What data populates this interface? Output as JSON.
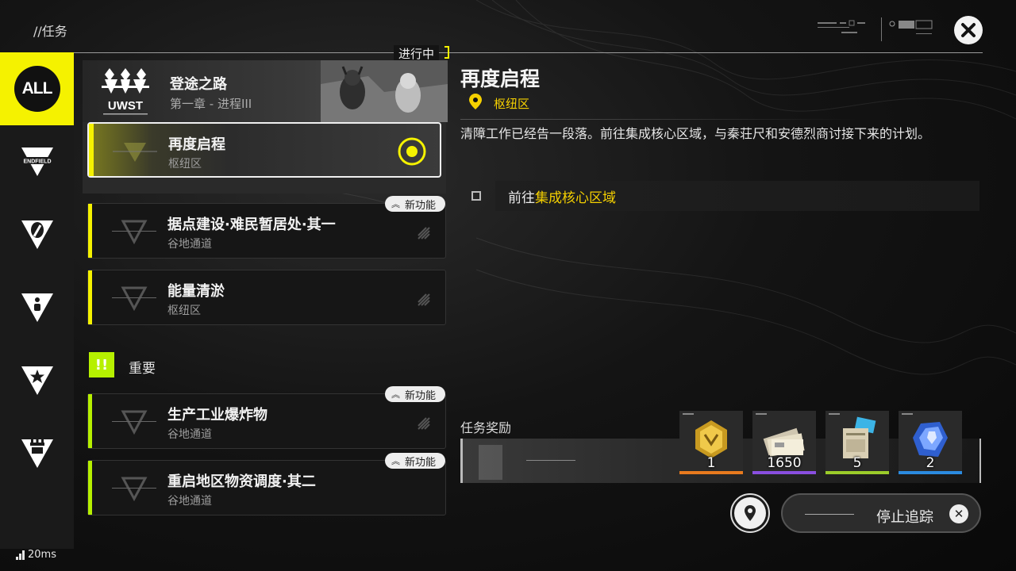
{
  "header": {
    "title": "//任务",
    "close_icon": "close-icon"
  },
  "sidebar": {
    "items": [
      {
        "label": "ALL",
        "icon": "all-icon",
        "active": true
      },
      {
        "label": "ENDFIELD",
        "icon": "endfield-icon",
        "active": false
      },
      {
        "label": "",
        "icon": "compass-icon",
        "active": false
      },
      {
        "label": "",
        "icon": "person-icon",
        "active": false
      },
      {
        "label": "",
        "icon": "star-icon",
        "active": false
      },
      {
        "label": "",
        "icon": "tower-icon",
        "active": false
      }
    ]
  },
  "list": {
    "in_progress_label": "进行中",
    "chapter": {
      "logo_text": "UWST",
      "name": "登途之路",
      "subtitle": "第一章 - 进程III"
    },
    "active_quest": {
      "name": "再度启程",
      "area": "枢纽区",
      "tracking_icon": "target-icon"
    },
    "quests": [
      {
        "name": "据点建设·难民暂居处·其一",
        "area": "谷地通道",
        "badge": "新功能"
      },
      {
        "name": "能量清淤",
        "area": "枢纽区",
        "badge": ""
      }
    ],
    "important": {
      "label": "重要",
      "icon_text": "!!",
      "quests": [
        {
          "name": "生产工业爆炸物",
          "area": "谷地通道",
          "badge": "新功能"
        },
        {
          "name": "重启地区物资调度·其二",
          "area": "谷地通道",
          "badge": "新功能"
        }
      ]
    }
  },
  "detail": {
    "title": "再度启程",
    "location": "枢纽区",
    "description": "清障工作已经告一段落。前往集成核心区域，与秦荘尺和安德烈商讨接下来的计划。",
    "objective": {
      "prefix": "前往",
      "highlight": "集成核心区域"
    },
    "rewards_label": "任务奖励",
    "rewards": [
      {
        "qty": "1",
        "color": "#e87a1e",
        "icon": "gold-badge-icon"
      },
      {
        "qty": "1650",
        "color": "#8a4fe0",
        "icon": "currency-bills-icon"
      },
      {
        "qty": "5",
        "color": "#9ccc2a",
        "icon": "exp-card-icon"
      },
      {
        "qty": "2",
        "color": "#2b8be0",
        "icon": "crystal-icon"
      }
    ],
    "stop_tracking_label": "停止追踪"
  },
  "status": {
    "ping": "20ms"
  }
}
